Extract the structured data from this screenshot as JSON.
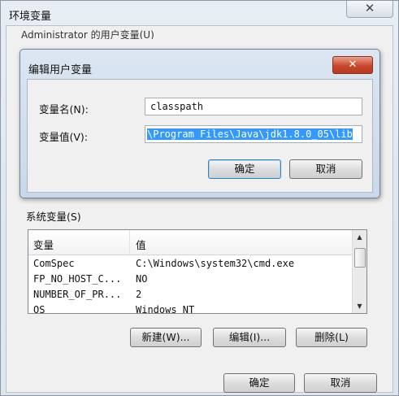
{
  "outer_window": {
    "title": "环境变量",
    "close_glyph": "✕",
    "user_section_label": "Administrator 的用户变量(U)"
  },
  "edit_dialog": {
    "title": "编辑用户变量",
    "close_glyph": "✕",
    "name_label": "变量名(N):",
    "name_value": "classpath",
    "value_label": "变量值(V):",
    "value_value": "\\Program Files\\Java\\jdk1.8.0_05\\lib",
    "ok_label": "确定",
    "cancel_label": "取消"
  },
  "system_vars": {
    "label": "系统变量(S)",
    "columns": [
      "变量",
      "值"
    ],
    "rows": [
      {
        "name": "ComSpec",
        "value": "C:\\Windows\\system32\\cmd.exe"
      },
      {
        "name": "FP_NO_HOST_C...",
        "value": "NO"
      },
      {
        "name": "NUMBER_OF_PR...",
        "value": "2"
      },
      {
        "name": "OS",
        "value": "Windows_NT"
      }
    ],
    "new_label": "新建(W)...",
    "edit_label": "编辑(I)...",
    "delete_label": "删除(L)"
  },
  "footer": {
    "ok_label": "确定",
    "cancel_label": "取消"
  },
  "icons": {
    "scroll_up": "▲",
    "scroll_down": "▼"
  }
}
